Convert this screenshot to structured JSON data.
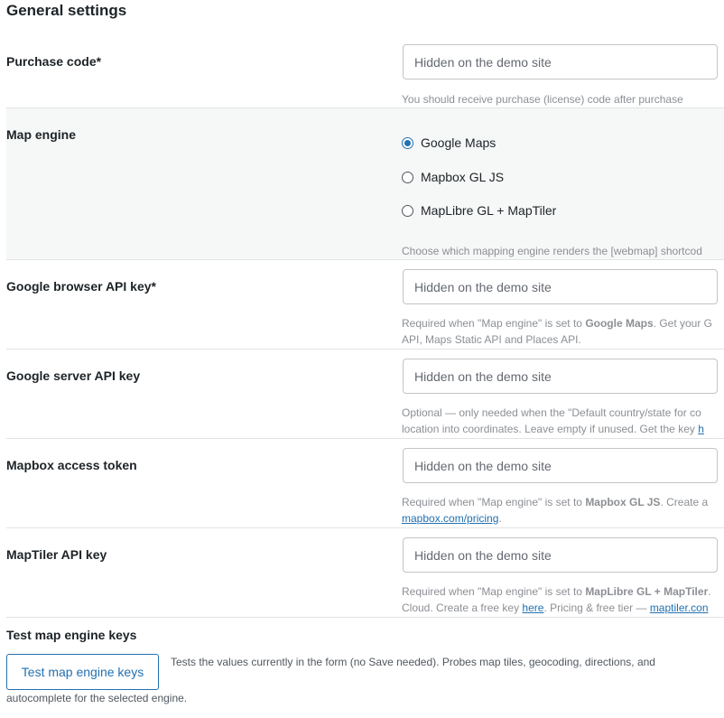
{
  "page": {
    "title": "General settings"
  },
  "purchase_code": {
    "label": "Purchase code*",
    "placeholder": "Hidden on the demo site",
    "hint": "You should receive purchase (license) code after purchase"
  },
  "map_engine": {
    "label": "Map engine",
    "options": [
      {
        "label": "Google Maps",
        "checked": true
      },
      {
        "label": "Mapbox GL JS",
        "checked": false
      },
      {
        "label": "MapLibre GL + MapTiler",
        "checked": false
      }
    ],
    "hint": "Choose which mapping engine renders the [webmap] shortcod"
  },
  "google_browser_key": {
    "label": "Google browser API key*",
    "placeholder": "Hidden on the demo site",
    "hint_line1_a": "Required when \"Map engine\" is set to ",
    "hint_line1_b": "Google Maps",
    "hint_line1_c": ". Get your G",
    "hint_line2": "API, Maps Static API and Places API."
  },
  "google_server_key": {
    "label": "Google server API key",
    "placeholder": "Hidden on the demo site",
    "hint_line1": "Optional — only needed when the \"Default country/state for co",
    "hint_line2_a": "location into coordinates. Leave empty if unused. Get the key ",
    "hint_line2_link": "h"
  },
  "mapbox_token": {
    "label": "Mapbox access token",
    "placeholder": "Hidden on the demo site",
    "hint_line1_a": "Required when \"Map engine\" is set to ",
    "hint_line1_b": "Mapbox GL JS",
    "hint_line1_c": ". Create a",
    "hint_line2_link": "mapbox.com/pricing",
    "hint_line2_b": "."
  },
  "maptiler_key": {
    "label": "MapTiler API key",
    "placeholder": "Hidden on the demo site",
    "hint_line1_a": "Required when \"Map engine\" is set to ",
    "hint_line1_b": "MapLibre GL + MapTiler",
    "hint_line1_c": ".",
    "hint_line2_a": "Cloud. Create a free key ",
    "hint_line2_link1": "here",
    "hint_line2_b": ". Pricing & free tier — ",
    "hint_line2_link2": "maptiler.con"
  },
  "test_keys": {
    "label": "Test map engine keys",
    "button": "Test map engine keys",
    "desc_line1": "Tests the values currently in the form (no Save needed). Probes map tiles, geocoding, directions, and",
    "desc_line2": "autocomplete for the selected engine."
  }
}
